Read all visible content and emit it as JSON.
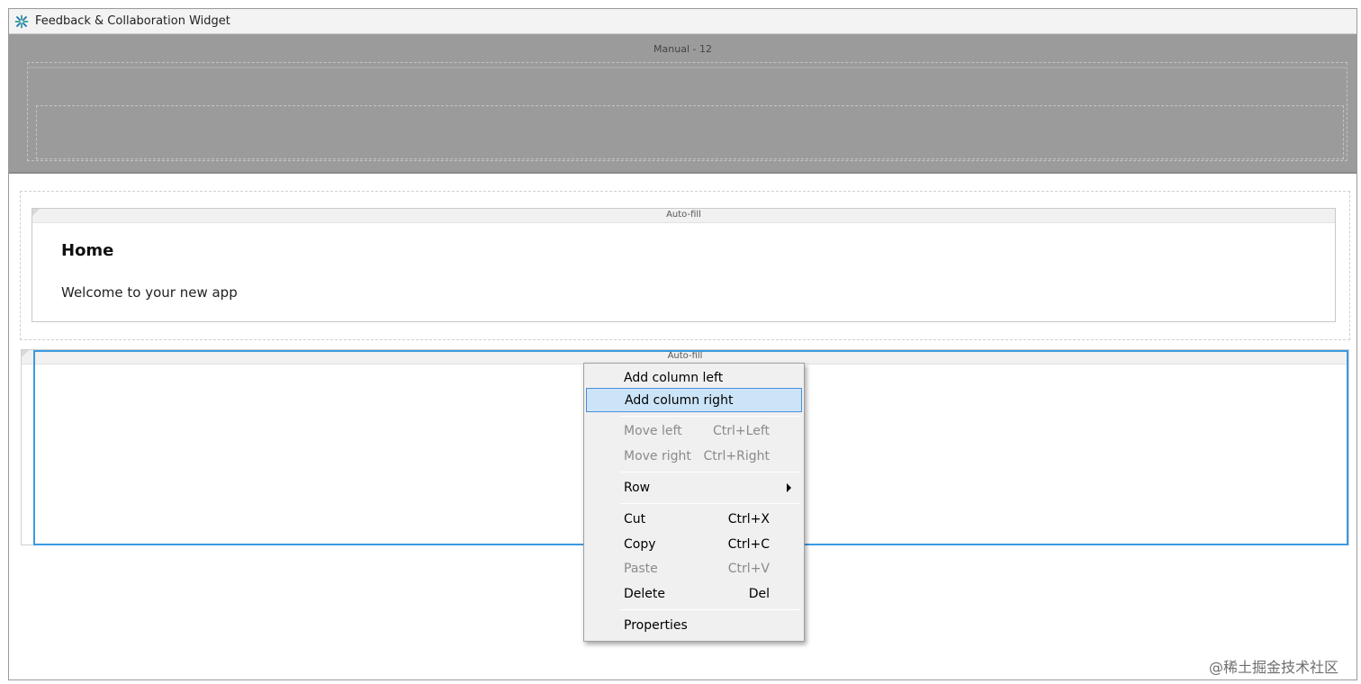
{
  "window": {
    "title": "Feedback & Collaboration Widget",
    "icon": "app-logo-icon"
  },
  "manual_region": {
    "caption": "Manual - 12"
  },
  "section_one": {
    "band_label": "Auto-fill",
    "heading": "Home",
    "body_text": "Welcome to your new app"
  },
  "section_two": {
    "band_label": "Auto-fill"
  },
  "context_menu": {
    "items": [
      {
        "label": "Add column left",
        "shortcut": "",
        "disabled": false
      },
      {
        "label": "Add column right",
        "shortcut": "",
        "disabled": false,
        "highlighted": true
      },
      {
        "label": "Move left",
        "shortcut": "Ctrl+Left",
        "disabled": true
      },
      {
        "label": "Move right",
        "shortcut": "Ctrl+Right",
        "disabled": true
      },
      {
        "label": "Row",
        "shortcut": "",
        "disabled": false,
        "submenu": true
      },
      {
        "label": "Cut",
        "shortcut": "Ctrl+X",
        "disabled": false
      },
      {
        "label": "Copy",
        "shortcut": "Ctrl+C",
        "disabled": false
      },
      {
        "label": "Paste",
        "shortcut": "Ctrl+V",
        "disabled": true
      },
      {
        "label": "Delete",
        "shortcut": "Del",
        "disabled": false
      },
      {
        "label": "Properties",
        "shortcut": "",
        "disabled": false
      }
    ]
  },
  "watermark": "@稀土掘金技术社区",
  "colors": {
    "selection": "#3b9ae1",
    "menu_highlight": "#cce4f7",
    "manual_overlay": "#9b9b9b"
  }
}
